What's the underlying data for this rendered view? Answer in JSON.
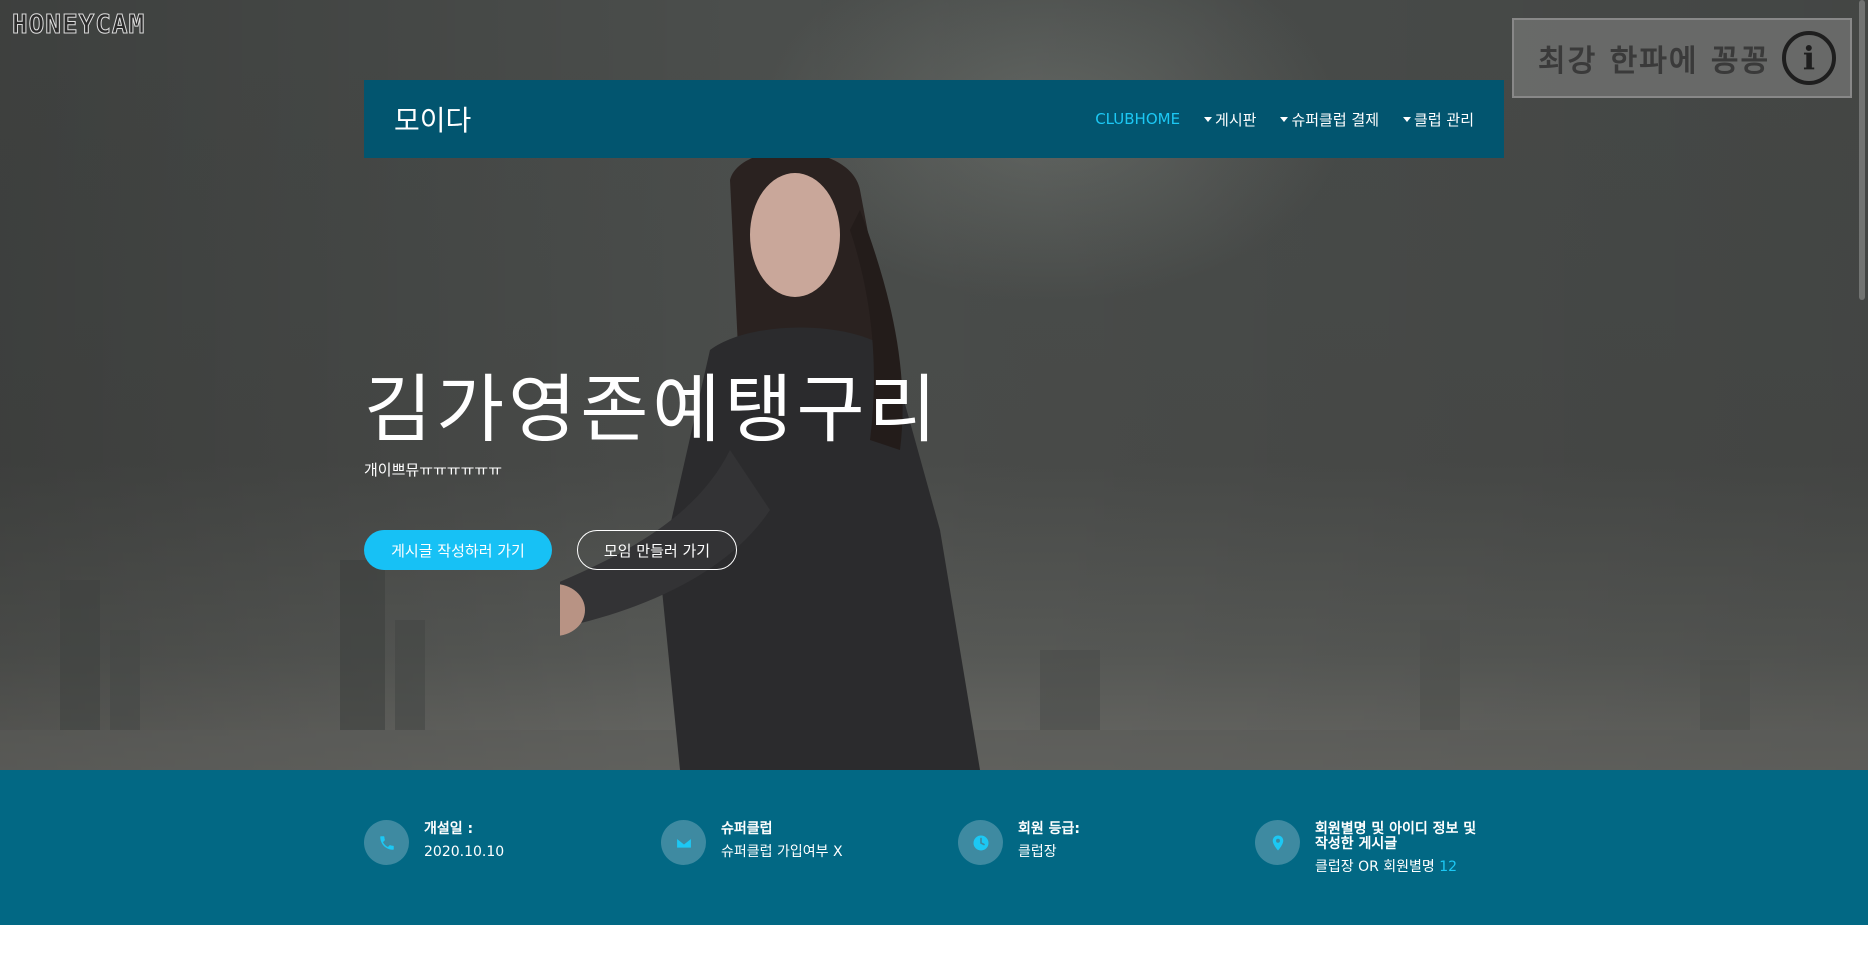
{
  "overlay": {
    "watermark": "HONEYCAM",
    "promo_text": "최강 한파에 꽁꽁",
    "info_glyph": "i"
  },
  "navbar": {
    "brand": "모이다",
    "items": [
      {
        "label": "CLUBHOME",
        "active": true,
        "dropdown": false
      },
      {
        "label": "게시판",
        "active": false,
        "dropdown": true
      },
      {
        "label": "슈퍼클럽 결제",
        "active": false,
        "dropdown": true
      },
      {
        "label": "클럽 관리",
        "active": false,
        "dropdown": true
      }
    ]
  },
  "hero": {
    "title": "김가영존예탱구리",
    "subtitle": "개이쁘뮤ㅠㅠㅠㅠㅠㅠ",
    "primary_button": "게시글 작성하러 가기",
    "secondary_button": "모임 만들러 가기"
  },
  "info": [
    {
      "icon": "phone-icon",
      "label": "개설일 :",
      "value": "2020.10.10"
    },
    {
      "icon": "envelope-icon",
      "label": "슈퍼클럽",
      "value": "슈퍼클럽 가입여부 X"
    },
    {
      "icon": "clock-icon",
      "label": "회원 등급:",
      "value": "클럽장"
    },
    {
      "icon": "map-marker-icon",
      "label_line1": "회원별명 및 아이디 정보 및",
      "label_line2": "작성한 게시글",
      "value_prefix": "클럽장 OR 회원별명",
      "value_accent": "12"
    }
  ],
  "colors": {
    "navbar_bg": "#02556f",
    "accent": "#1cc8f4",
    "info_strip_bg": "#026884",
    "icon_circle_bg": "#3e8aa1"
  }
}
